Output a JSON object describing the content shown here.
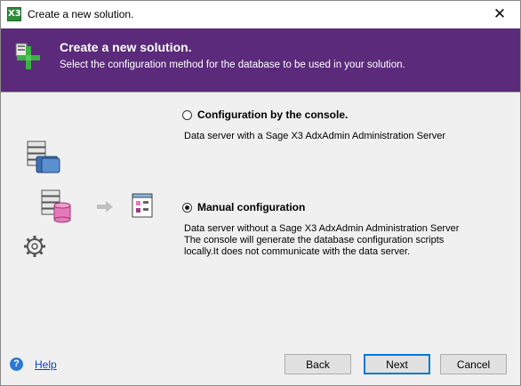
{
  "window": {
    "title": "Create a new solution.",
    "icon_text": "X3",
    "close_glyph": "✕"
  },
  "header": {
    "title": "Create a new solution.",
    "subtitle": "Select the configuration method for the database to be used in your solution.",
    "background": "#5b2a7b",
    "icon": "add-solution-icon"
  },
  "options": [
    {
      "label": "Configuration by the console.",
      "selected": false,
      "description": [
        "Data server with a Sage X3 AdxAdmin Administration Server"
      ]
    },
    {
      "label": "Manual configuration",
      "selected": true,
      "description": [
        "Data server without a Sage X3 AdxAdmin Administration Server",
        "The console will generate the database configuration scripts",
        "locally.It does not communicate with the data server."
      ]
    }
  ],
  "footer": {
    "help": "Help",
    "back": "Back",
    "next": "Next",
    "cancel": "Cancel"
  }
}
